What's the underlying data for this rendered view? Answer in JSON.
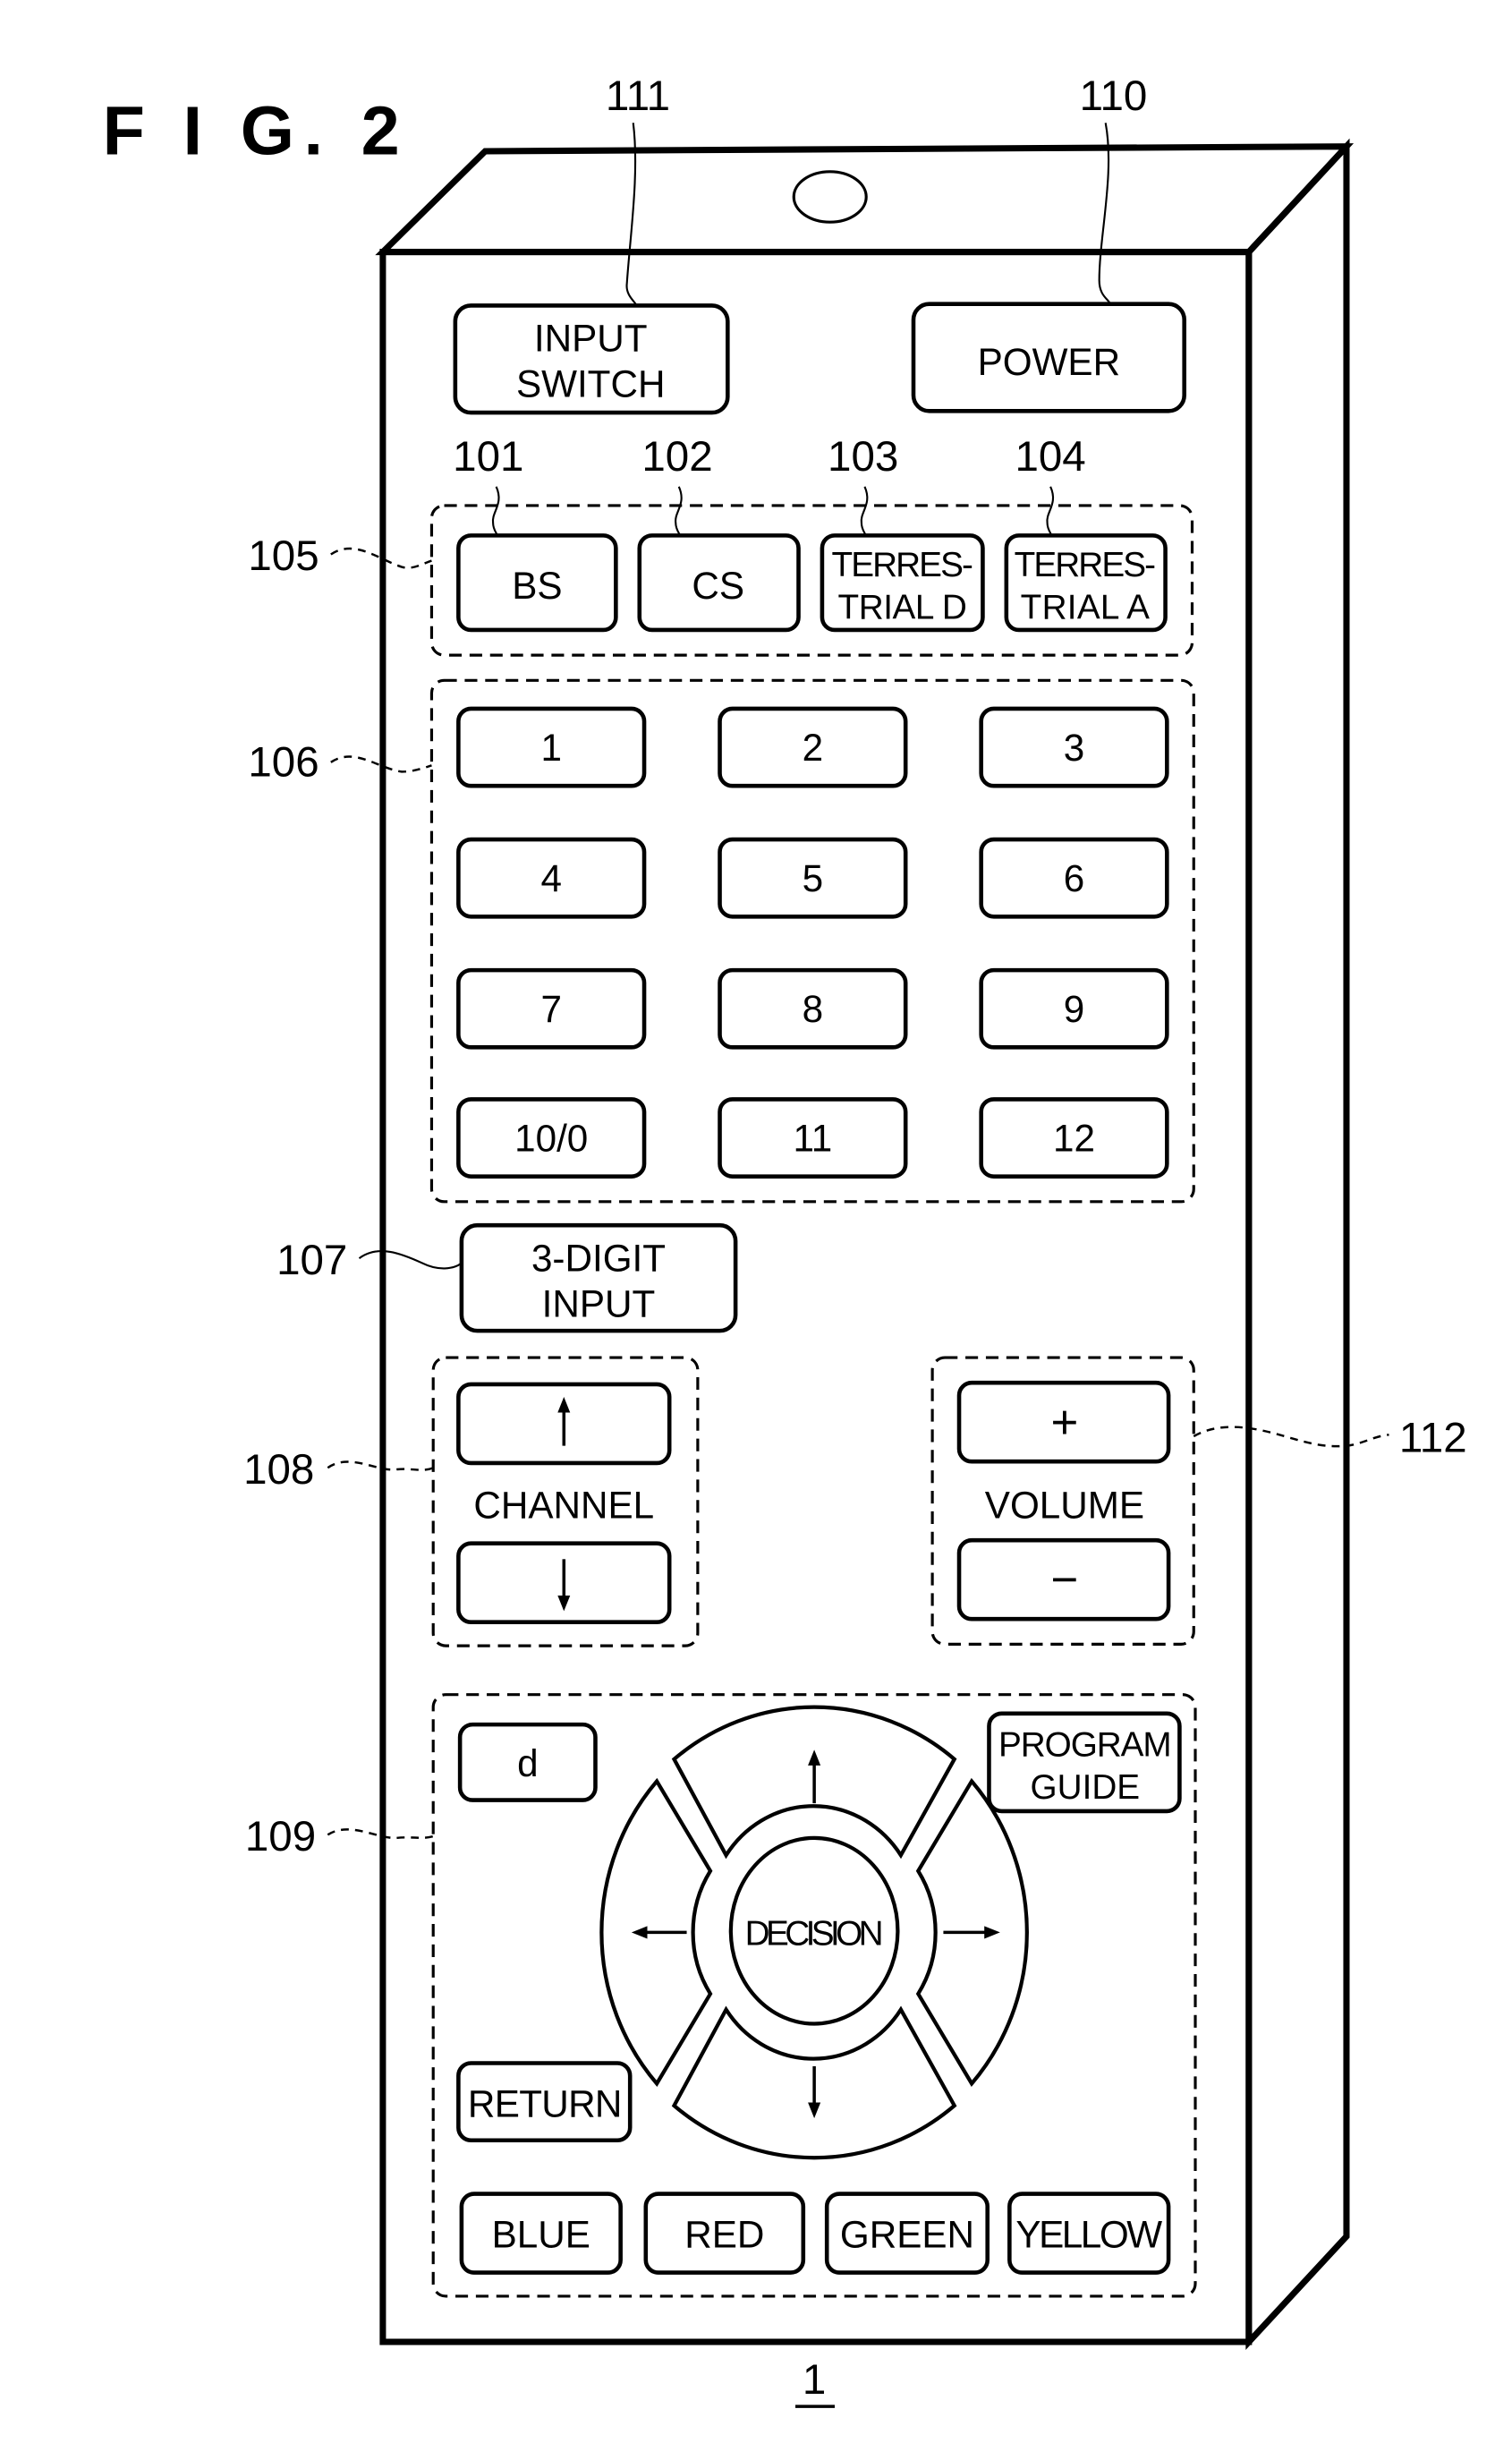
{
  "figure": {
    "title": "F I G. 2",
    "device_ref": "1"
  },
  "reference_numerals": {
    "input_switch": "111",
    "power": "110",
    "bs": "101",
    "cs": "102",
    "terrestrial_d": "103",
    "terrestrial_a": "104",
    "broadcast_group": "105",
    "numeric_group": "106",
    "three_digit": "107",
    "channel_group": "108",
    "navigation_group": "109",
    "volume_group": "112"
  },
  "buttons": {
    "input_switch": [
      "INPUT",
      "SWITCH"
    ],
    "power": "POWER",
    "broadcast": {
      "bs": "BS",
      "cs": "CS",
      "terrestrial_d": [
        "TERRES-",
        "TRIAL D"
      ],
      "terrestrial_a": [
        "TERRES-",
        "TRIAL A"
      ]
    },
    "numeric": [
      "1",
      "2",
      "3",
      "4",
      "5",
      "6",
      "7",
      "8",
      "9",
      "10/0",
      "11",
      "12"
    ],
    "three_digit_input": [
      "3-DIGIT",
      "INPUT"
    ],
    "channel": {
      "label": "CHANNEL",
      "up_icon": "arrow-up",
      "down_icon": "arrow-down"
    },
    "volume": {
      "label": "VOLUME",
      "plus": "+",
      "minus": "−"
    },
    "d": "d",
    "program_guide": [
      "PROGRAM",
      "GUIDE"
    ],
    "return": "RETURN",
    "decision": "DECISION",
    "dpad_icons": [
      "arrow-up",
      "arrow-down",
      "arrow-left",
      "arrow-right"
    ],
    "colors": [
      "BLUE",
      "RED",
      "GREEN",
      "YELLOW"
    ]
  }
}
